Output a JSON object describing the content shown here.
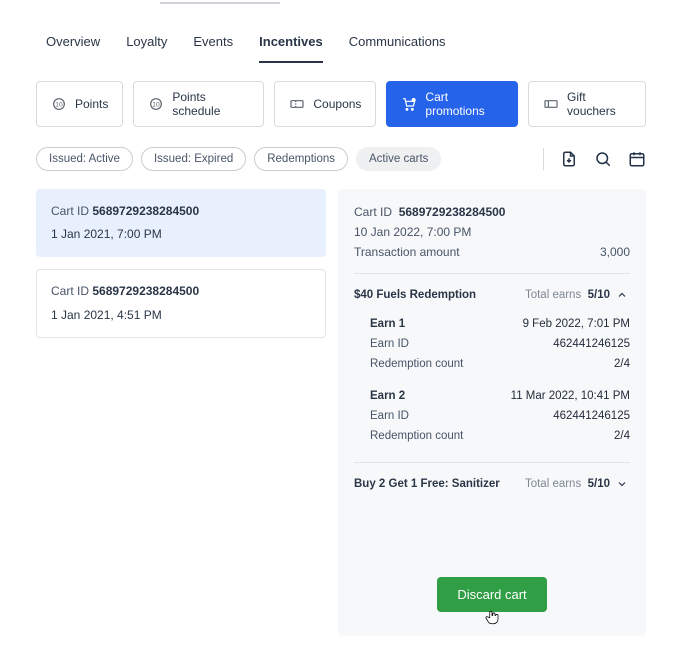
{
  "tabs": {
    "items": [
      {
        "label": "Overview"
      },
      {
        "label": "Loyalty"
      },
      {
        "label": "Events"
      },
      {
        "label": "Incentives"
      },
      {
        "label": "Communications"
      }
    ],
    "active_index": 3
  },
  "subtabs": {
    "items": [
      {
        "label": "Points"
      },
      {
        "label": "Points schedule"
      },
      {
        "label": "Coupons"
      },
      {
        "label": "Cart promotions"
      },
      {
        "label": "Gift vouchers"
      }
    ],
    "active_index": 3
  },
  "filters": {
    "pills": [
      {
        "label": "Issued: Active"
      },
      {
        "label": "Issued: Expired"
      },
      {
        "label": "Redemptions"
      },
      {
        "label": "Active carts"
      }
    ],
    "active_index": 3
  },
  "left_cards": [
    {
      "prefix": "Cart ID",
      "id": "5689729238284500",
      "date": "1 Jan 2021, 7:00 PM"
    },
    {
      "prefix": "Cart ID",
      "id": "5689729238284500",
      "date": "1 Jan 2021, 4:51 PM"
    }
  ],
  "details": {
    "cart_label": "Cart ID",
    "cart_id": "5689729238284500",
    "date": "10 Jan 2022, 7:00 PM",
    "txn_label": "Transaction amount",
    "txn_value": "3,000"
  },
  "promotions": [
    {
      "name": "$40 Fuels Redemption",
      "total_earns_label": "Total earns",
      "total_earns_value": "5/10",
      "expanded": true,
      "earns": [
        {
          "title": "Earn 1",
          "date": "9 Feb 2022, 7:01 PM",
          "id_label": "Earn ID",
          "id_value": "462441246125",
          "rc_label": "Redemption count",
          "rc_value": "2/4"
        },
        {
          "title": "Earn 2",
          "date": "11 Mar 2022, 10:41 PM",
          "id_label": "Earn ID",
          "id_value": "462441246125",
          "rc_label": "Redemption count",
          "rc_value": "2/4"
        }
      ]
    },
    {
      "name": "Buy 2 Get 1 Free: Sanitizer",
      "total_earns_label": "Total earns",
      "total_earns_value": "5/10",
      "expanded": false
    }
  ],
  "discard_label": "Discard cart"
}
